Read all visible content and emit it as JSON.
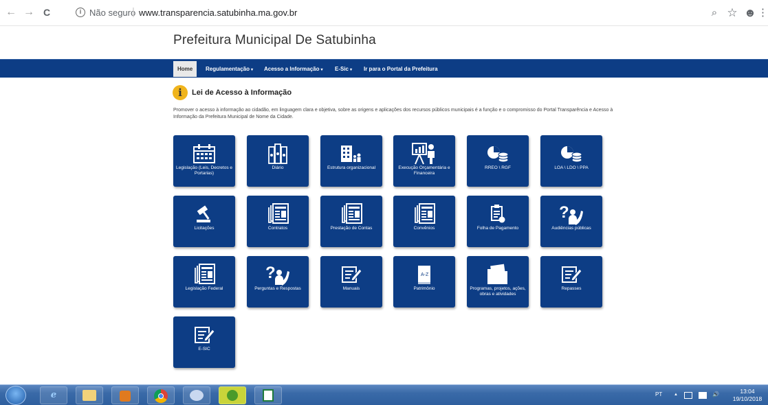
{
  "browser": {
    "back_icon": "←",
    "forward_icon": "→",
    "reload_icon": "C",
    "info_icon": "i",
    "security_label": "Não seguro",
    "url": "www.transparencia.satubinha.ma.gov.br",
    "zoom_icon": "⌕",
    "star_icon": "☆",
    "profile_icon": "☻",
    "menu_icon": "⋮"
  },
  "site": {
    "title": "Prefeitura Municipal De Satubinha"
  },
  "nav": {
    "home": "Home",
    "regulamentacao": "Regulamentação",
    "acesso": "Acesso a Informação",
    "esic": "E-Sic",
    "portal": "Ir para o Portal da Prefeitura",
    "caret": "▾"
  },
  "section": {
    "icon": "i",
    "title": "Lei de Acesso à Informação",
    "description": "Promover o acesso à informação ao cidadão, em linguagem clara e objetiva, sobre as origens e aplicações dos recursos públicos municipais é a função e o compromisso do Portal Transparência e Acesso à Informação da Prefeitura Municipal de Nome da Cidade."
  },
  "tiles": [
    {
      "label": "Legislação (Leis, Decretos e Portarias)",
      "icon": "calendar-icon"
    },
    {
      "label": "Diário",
      "icon": "books-icon"
    },
    {
      "label": "Estrutura organizacional",
      "icon": "building-icon"
    },
    {
      "label": "Execução Orçamentária e Financeira",
      "icon": "presentation-icon"
    },
    {
      "label": "RREO \\ RGF",
      "icon": "pie-coins-icon"
    },
    {
      "label": "LOA \\ LDO \\ PPA",
      "icon": "pie-coins-icon"
    },
    {
      "label": "Licitações",
      "icon": "gavel-icon"
    },
    {
      "label": "Contratos",
      "icon": "newspaper-icon"
    },
    {
      "label": "Prestação de Contas",
      "icon": "newspaper-icon"
    },
    {
      "label": "Convênios",
      "icon": "newspaper-icon"
    },
    {
      "label": "Folha de Pagamento",
      "icon": "clipboard-icon"
    },
    {
      "label": "Audiências públicas",
      "icon": "question-person-icon"
    },
    {
      "label": "Legislação Federal",
      "icon": "newspaper-icon"
    },
    {
      "label": "Perguntas e Respostas",
      "icon": "question-person-icon"
    },
    {
      "label": "Manuais",
      "icon": "edit-icon"
    },
    {
      "label": "Patrimônio",
      "icon": "book-az-icon"
    },
    {
      "label": "Programas, projetos, ações, obras e atividades",
      "icon": "folder-icon"
    },
    {
      "label": "Repasses",
      "icon": "edit-icon"
    },
    {
      "label": "E-SIC",
      "icon": "edit-icon"
    }
  ],
  "taskbar": {
    "lang": "PT",
    "tray_arrow": "▲",
    "volume": "🔊",
    "time": "13:04",
    "date": "19/10/2018"
  }
}
